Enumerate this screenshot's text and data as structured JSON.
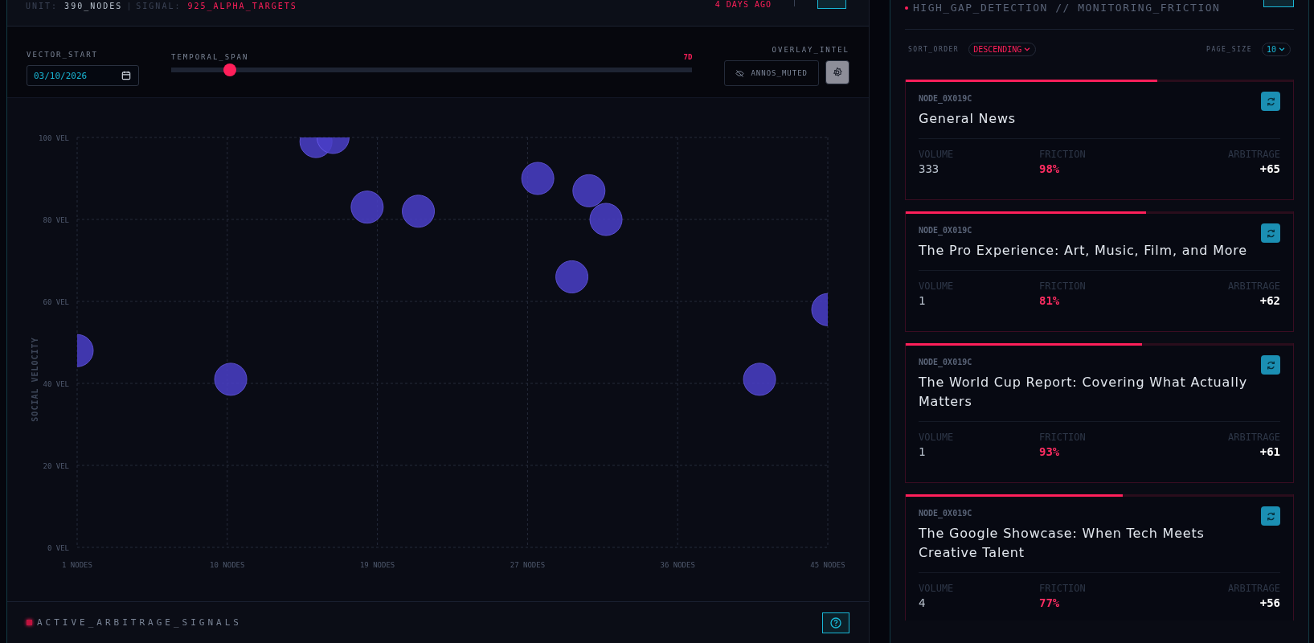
{
  "header": {
    "unit_label": "UNIT:",
    "unit_value": "390_NODES",
    "signal_label": "SIGNAL:",
    "signal_value": "925_ALPHA_TARGETS",
    "updated": "4 DAYS AGO"
  },
  "controls": {
    "vector_start": {
      "label": "VECTOR_START",
      "value": "03/10/2026"
    },
    "temporal_span": {
      "label": "TEMPORAL_SPAN",
      "reading": "7D",
      "level": 0.113
    },
    "overlay": {
      "label": "OVERLAY_INTEL",
      "annotations_button": "ANNOS_MUTED",
      "settings_selected": true
    }
  },
  "chart": {
    "chart_data": {
      "type": "scatter",
      "ylabel": "SOCIAL VELOCITY",
      "xlim": [
        1,
        45
      ],
      "ylim": [
        0,
        100
      ],
      "xticks": [
        {
          "value": 1,
          "label": "1 NODES"
        },
        {
          "value": 9.8,
          "label": "10 NODES"
        },
        {
          "value": 18.6,
          "label": "19 NODES"
        },
        {
          "value": 27.4,
          "label": "27 NODES"
        },
        {
          "value": 36.2,
          "label": "36 NODES"
        },
        {
          "value": 45,
          "label": "45 NODES"
        }
      ],
      "yticks": [
        {
          "value": 0,
          "label": "0 VEL"
        },
        {
          "value": 20,
          "label": "20 VEL"
        },
        {
          "value": 40,
          "label": "40 VEL"
        },
        {
          "value": 60,
          "label": "60 VEL"
        },
        {
          "value": 80,
          "label": "80 VEL"
        },
        {
          "value": 100,
          "label": "100 VEL"
        }
      ],
      "grid": true,
      "x": [
        1,
        10,
        15,
        16,
        18,
        21,
        28,
        31,
        32,
        30,
        41,
        45
      ],
      "series": [
        {
          "color": "#4a3fc8",
          "values": [
            48,
            41,
            99,
            100,
            83,
            82,
            90,
            87,
            80,
            66,
            41,
            58
          ]
        }
      ]
    }
  },
  "footer": {
    "title": "ACTIVE_ARBITRAGE_SIGNALS"
  },
  "panel": {
    "title": "HIGH_GAP_DETECTION // MONITORING_FRICTION",
    "sort_label": "SORT_ORDER",
    "sort_value": "DESCENDING",
    "page_size_label": "PAGE_SIZE",
    "page_size_value": "10",
    "cards": [
      {
        "node": "NODE_0X019C",
        "title": "General News",
        "volume_label": "VOLUME",
        "volume": "333",
        "friction_label": "FRICTION",
        "friction": "98%",
        "arbitrage_label": "ARBITRAGE",
        "arbitrage": "+65",
        "level": 0.65
      },
      {
        "node": "NODE_0X019C",
        "title": "The Pro Experience: Art, Music, Film, and More",
        "volume_label": "VOLUME",
        "volume": "1",
        "friction_label": "FRICTION",
        "friction": "81%",
        "arbitrage_label": "ARBITRAGE",
        "arbitrage": "+62",
        "level": 0.62
      },
      {
        "node": "NODE_0X019C",
        "title": "The World Cup Report: Covering What Actually Matters",
        "volume_label": "VOLUME",
        "volume": "1",
        "friction_label": "FRICTION",
        "friction": "93%",
        "arbitrage_label": "ARBITRAGE",
        "arbitrage": "+61",
        "level": 0.61
      },
      {
        "node": "NODE_0X019C",
        "title": "The Google Showcase: When Tech Meets Creative Talent",
        "volume_label": "VOLUME",
        "volume": "4",
        "friction_label": "FRICTION",
        "friction": "77%",
        "arbitrage_label": "ARBITRAGE",
        "arbitrage": "+56",
        "level": 0.56
      }
    ]
  }
}
